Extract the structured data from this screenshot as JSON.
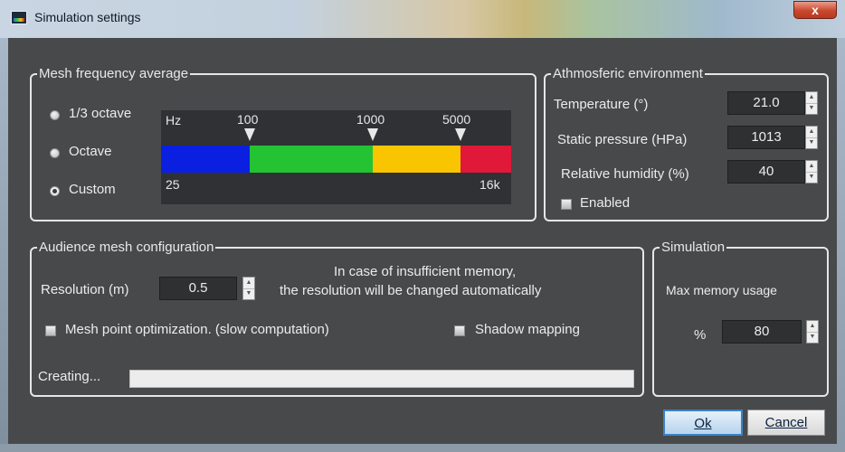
{
  "window": {
    "title": "Simulation settings",
    "close_label": "x"
  },
  "mesh_frequency": {
    "legend": "Mesh frequency average",
    "options": [
      {
        "label": "1/3 octave",
        "selected": false
      },
      {
        "label": "Octave",
        "selected": false
      },
      {
        "label": "Custom",
        "selected": true
      }
    ],
    "bar": {
      "unit_label": "Hz",
      "min_label": "25",
      "max_label": "16k",
      "markers": [
        "100",
        "1000",
        "5000"
      ],
      "colors": [
        "#0b1fe0",
        "#23c334",
        "#f9c400",
        "#e0183a"
      ]
    }
  },
  "environment": {
    "legend": "Athmosferic environment",
    "temperature_label": "Temperature (°)",
    "temperature_value": "21.0",
    "pressure_label": "Static pressure (HPa)",
    "pressure_value": "1013",
    "humidity_label": "Relative humidity (%)",
    "humidity_value": "40",
    "enabled_label": "Enabled"
  },
  "audience_mesh": {
    "legend": "Audience mesh configuration",
    "resolution_label": "Resolution (m)",
    "resolution_value": "0.5",
    "memory_note_line1": "In case of insufficient memory,",
    "memory_note_line2": "the resolution will be changed automatically",
    "optimization_label": "Mesh point optimization. (slow computation)",
    "shadow_label": "Shadow mapping",
    "status_label": "Creating...",
    "progress": 0
  },
  "simulation": {
    "legend": "Simulation",
    "max_memory_label": "Max memory  usage",
    "percent_label": "%",
    "percent_value": "80"
  },
  "buttons": {
    "ok": "Ok",
    "cancel": "Cancel"
  }
}
